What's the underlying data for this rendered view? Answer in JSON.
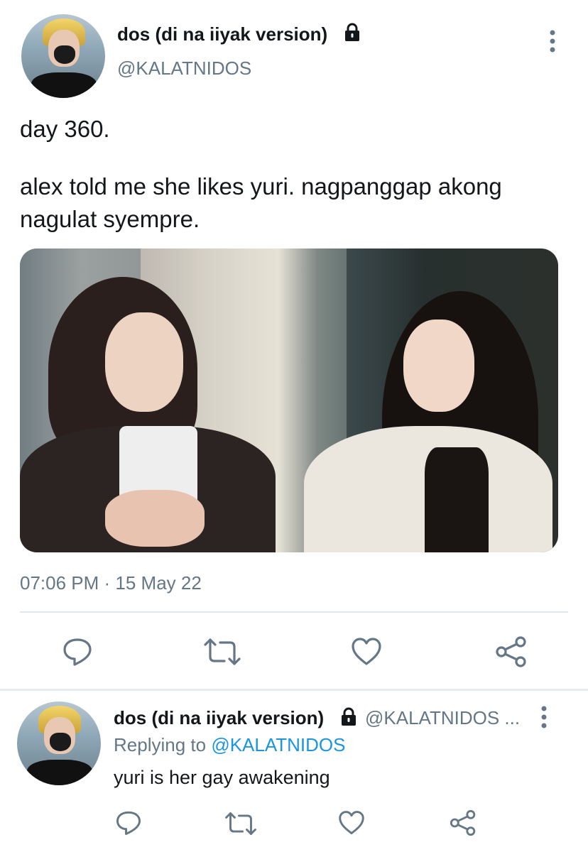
{
  "tweet": {
    "display_name": "dos (di na iiyak version)",
    "handle": "@KALATNIDOS",
    "text_line1": "day 360.",
    "text_line2": "alex told me she likes yuri. nagpanggap akong nagulat syempre.",
    "timestamp": "07:06 PM · 15 May 22",
    "icons": [
      "lock-icon",
      "more-icon",
      "reply-icon",
      "retweet-icon",
      "like-icon",
      "share-icon"
    ]
  },
  "reply": {
    "display_name": "dos (di na iiyak version)",
    "handle": "@KALATNIDOS ...",
    "replying_prefix": "Replying to",
    "replying_handle": "@KALATNIDOS",
    "text": "yuri is her gay awakening"
  },
  "colors": {
    "text": "#14171a",
    "muted": "#657786",
    "link": "#1b95e0",
    "divider": "#e1e8ed"
  }
}
